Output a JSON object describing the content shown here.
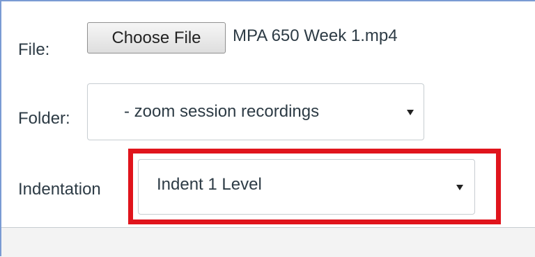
{
  "form": {
    "file_label": "File:",
    "choose_file_label": "Choose File",
    "file_name": "MPA 650 Week 1.mp4",
    "folder_label": "Folder:",
    "folder_value": "- zoom session recordings",
    "indentation_label": "Indentation",
    "indentation_value": "Indent 1 Level"
  },
  "icons": {
    "dropdown": "triangle-down-icon"
  },
  "colors": {
    "highlight": "#e0141c",
    "frame_border": "#7a9bd3",
    "text": "#2d3b45",
    "footer": "#f3f3f3"
  }
}
